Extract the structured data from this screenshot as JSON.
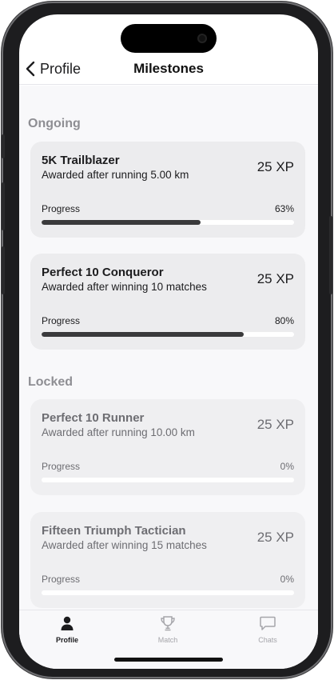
{
  "nav": {
    "back_label": "Profile",
    "title": "Milestones"
  },
  "sections": {
    "ongoing": "Ongoing",
    "locked": "Locked"
  },
  "cards": [
    {
      "title": "5K Trailblazer",
      "subtitle": "Awarded after running 5.00 km",
      "xp": "25 XP",
      "progress_label": "Progress",
      "progress_text": "63%",
      "progress": 0.63,
      "state": "ongoing"
    },
    {
      "title": "Perfect 10 Conqueror",
      "subtitle": "Awarded after winning 10 matches",
      "xp": "25 XP",
      "progress_label": "Progress",
      "progress_text": "80%",
      "progress": 0.8,
      "state": "ongoing"
    },
    {
      "title": "Perfect 10 Runner",
      "subtitle": "Awarded after running 10.00 km",
      "xp": "25 XP",
      "progress_label": "Progress",
      "progress_text": "0%",
      "progress": 0,
      "state": "locked"
    },
    {
      "title": "Fifteen Triumph Tactician",
      "subtitle": "Awarded after winning 15 matches",
      "xp": "25 XP",
      "progress_label": "Progress",
      "progress_text": "0%",
      "progress": 0,
      "state": "locked"
    }
  ],
  "tabs": [
    {
      "label": "Profile",
      "icon": "person-icon",
      "active": true
    },
    {
      "label": "Match",
      "icon": "trophy-icon",
      "active": false
    },
    {
      "label": "Chats",
      "icon": "chat-bubble-icon",
      "active": false
    }
  ],
  "colors": {
    "progress_fill": "#3a3a3c",
    "progress_track": "#ffffff",
    "card_background": "#ececee",
    "section_header": "#8e8e93",
    "inactive_tab": "#a5a5aa"
  }
}
